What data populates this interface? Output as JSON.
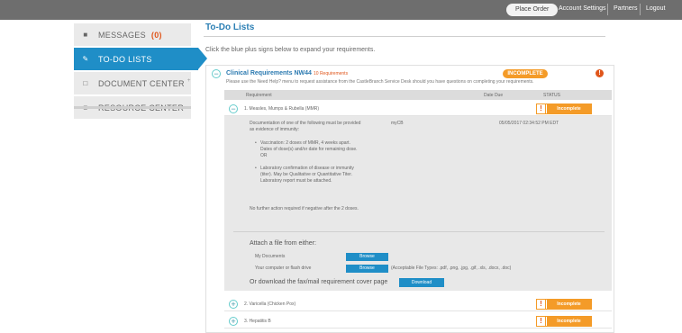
{
  "topbar": {
    "place_order": "Place Order",
    "account_settings": "Account Settings",
    "partners": "Partners",
    "logout": "Logout"
  },
  "sidebar": {
    "items": [
      {
        "label": "MESSAGES",
        "badge": "(0)",
        "icon": "envelope-icon"
      },
      {
        "label": "TO-DO LISTS",
        "icon": "checklist-icon",
        "active": true
      },
      {
        "label": "DOCUMENT CENTER",
        "sup": "+",
        "icon": "document-icon"
      },
      {
        "label": "RESOURCE CENTER",
        "icon": "folder-icon"
      }
    ]
  },
  "main": {
    "title": "To-Do Lists",
    "instruction": "Click the blue plus signs below to expand your requirements.",
    "requirement": {
      "title": "Clinical Requirements NW44",
      "count": "10 Requirements",
      "status": "INCOMPLETE",
      "alert": "!",
      "help": "Please use the Need Help? menu to request assistance from the CastleBranch Service Desk should you have questions on completing your requirements."
    },
    "table": {
      "col_requirement": "Requirement",
      "col_date_due": "Date Due",
      "col_status": "STATUS"
    },
    "rows": [
      {
        "label": "1. Measles, Mumps & Rubella (MMR)",
        "status": "Incomplete",
        "expanded": true
      },
      {
        "label": "2. Varicella (Chicken Pox)",
        "status": "Incomplete"
      },
      {
        "label": "3. Hepatitis B",
        "status": "Incomplete"
      }
    ],
    "detail": {
      "doc_intro": "Documentation of one of the following must be provided as evidence of immunity:",
      "source": "myCB",
      "timestamp": "05/05/2017 02:34:52 PM EDT",
      "bullet1": "Vaccination: 2 doses of MMR, 4 weeks apart. Dates of dose(s) and/or date for remaining dose. OR",
      "bullet2": "Laboratory confirmation of disease or immunity (titer). May be Qualitative or Quantitative Titer. Laboratory report must be attached.",
      "note": "No further action required if negative after the 2 doses.",
      "attach_title": "Attach a file from either:",
      "my_documents": "My Documents",
      "computer": "Your computer or flash drive",
      "browse": "Browse",
      "file_types": "(Acceptable File Types: .pdf, .png, .jpg, .gif, .xls, .docx, .doc)",
      "download_text": "Or download the fax/mail requirement cover page",
      "download": "Download"
    }
  },
  "colors": {
    "accent_blue": "#1f8ec7",
    "status_orange": "#f49b28",
    "alert_red": "#e0561b"
  }
}
